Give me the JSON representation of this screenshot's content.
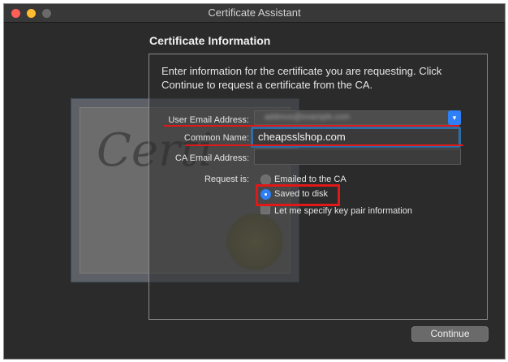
{
  "window": {
    "title": "Certificate Assistant"
  },
  "section_title": "Certificate Information",
  "description": "Enter information for the certificate you are requesting. Click Continue to request a certificate from the CA.",
  "form": {
    "user_email_label": "User Email Address:",
    "user_email_value": "address@example.com",
    "common_name_label": "Common Name:",
    "common_name_value": "cheapsslshop.com",
    "ca_email_label": "CA Email Address:",
    "ca_email_value": "",
    "request_label": "Request is:",
    "options": {
      "emailed": "Emailed to the CA",
      "saved": "Saved to disk",
      "specify_key": "Let me specify key pair information"
    },
    "selected_option": "saved"
  },
  "buttons": {
    "continue": "Continue"
  },
  "colors": {
    "accent": "#2f7ff6",
    "annotation": "#e01818",
    "window_bg": "#2b2b2b"
  }
}
